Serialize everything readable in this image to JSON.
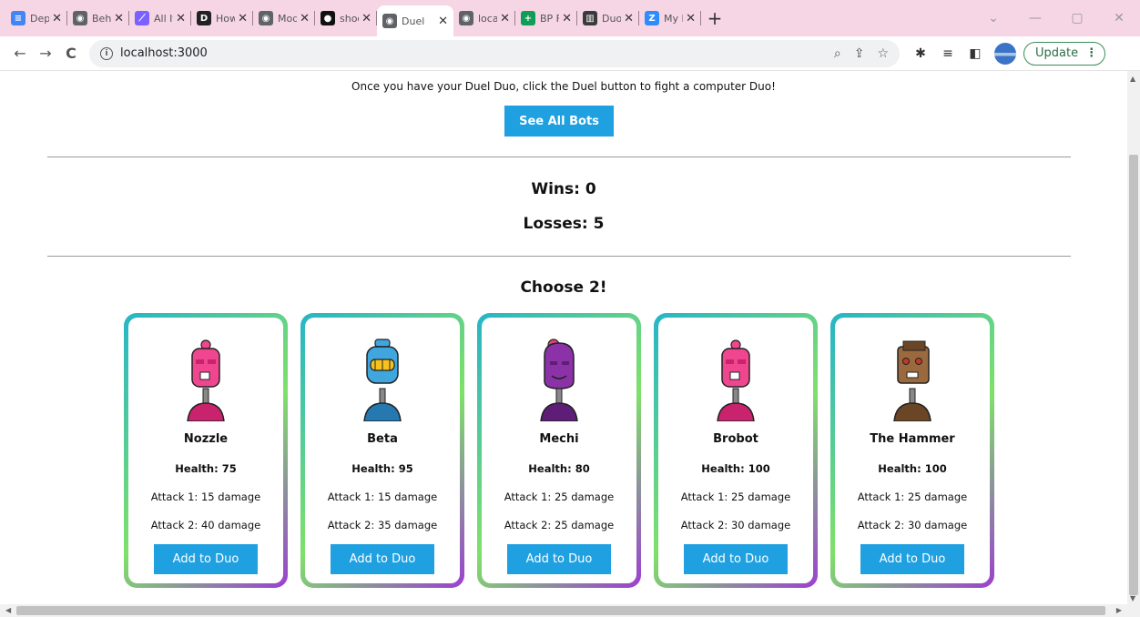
{
  "browser": {
    "tabs": [
      {
        "label": "Depl",
        "icon": "docs-icon",
        "color": "#4285f4",
        "glyph": "≡"
      },
      {
        "label": "Beha",
        "icon": "globe-icon",
        "color": "#5f6368",
        "glyph": "◉"
      },
      {
        "label": "All It",
        "icon": "pen-icon",
        "color": "#7b61ff",
        "glyph": "⟋"
      },
      {
        "label": "How",
        "icon": "dev-icon",
        "color": "#222222",
        "glyph": "D"
      },
      {
        "label": "Mod",
        "icon": "globe-icon",
        "color": "#5f6368",
        "glyph": "◉"
      },
      {
        "label": "shod",
        "icon": "github-icon",
        "color": "#111111",
        "glyph": "●"
      },
      {
        "label": "Duel",
        "icon": "globe-icon",
        "color": "#5f6368",
        "glyph": "◉",
        "active": true
      },
      {
        "label": "locall",
        "icon": "globe-icon",
        "color": "#5f6368",
        "glyph": "◉"
      },
      {
        "label": "BP Fc",
        "icon": "sheets-icon",
        "color": "#0f9d58",
        "glyph": "+"
      },
      {
        "label": "Duo_",
        "icon": "trello-icon",
        "color": "#3a3a3a",
        "glyph": "▥"
      },
      {
        "label": "My N",
        "icon": "zoom-icon",
        "color": "#2d8cff",
        "glyph": "Z"
      }
    ],
    "close_glyph": "✕",
    "new_tab_glyph": "+",
    "url": "localhost:3000",
    "update_label": "Update"
  },
  "page": {
    "intro": "Once you have your Duel Duo, click the Duel button to fight a computer Duo!",
    "see_all_label": "See All Bots",
    "wins": "Wins: 0",
    "losses": "Losses: 5",
    "choose": "Choose 2!",
    "add_label": "Add to Duo",
    "bots": [
      {
        "name": "Nozzle",
        "health": "Health: 75",
        "attack1": "Attack 1: 15 damage",
        "attack2": "Attack 2: 40 damage",
        "color": "#f0468f",
        "shade": "#c8236c",
        "style": "tall"
      },
      {
        "name": "Beta",
        "health": "Health: 95",
        "attack1": "Attack 1: 15 damage",
        "attack2": "Attack 2: 35 damage",
        "color": "#3fa6de",
        "shade": "#2578b0",
        "style": "dome"
      },
      {
        "name": "Mechi",
        "health": "Health: 80",
        "attack1": "Attack 1: 25 damage",
        "attack2": "Attack 2: 25 damage",
        "color": "#8b32a8",
        "shade": "#5e1d77",
        "style": "round"
      },
      {
        "name": "Brobot",
        "health": "Health: 100",
        "attack1": "Attack 1: 25 damage",
        "attack2": "Attack 2: 30 damage",
        "color": "#f0468f",
        "shade": "#c8236c",
        "style": "tall"
      },
      {
        "name": "The Hammer",
        "health": "Health: 100",
        "attack1": "Attack 1: 25 damage",
        "attack2": "Attack 2: 30 damage",
        "color": "#9a6a3e",
        "shade": "#6b4626",
        "style": "box"
      }
    ]
  }
}
